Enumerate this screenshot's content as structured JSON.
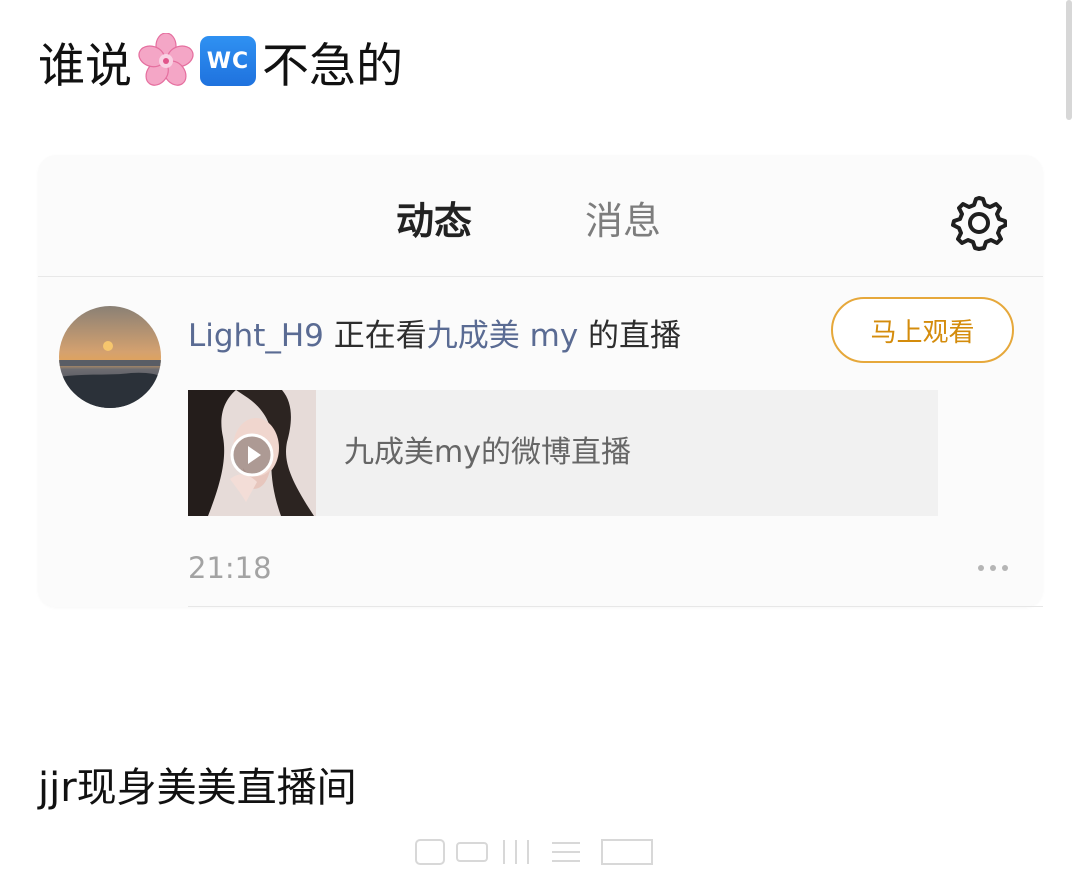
{
  "page": {
    "title_prefix": "谁说",
    "title_badge": "WC",
    "title_suffix": "不急的",
    "caption": "jjr现身美美直播间"
  },
  "card": {
    "tabs": [
      {
        "label": "动态",
        "active": true
      },
      {
        "label": "消息",
        "active": false
      }
    ],
    "feed": {
      "user": "Light_H9",
      "verb": " 正在看",
      "streamer": "九成美 my",
      "suffix": " 的直播",
      "button": "马上观看",
      "live_title": "九成美my的微博直播",
      "time": "21:18"
    }
  },
  "icons": {
    "blossom": "cherry-blossom-icon",
    "wc": "wc-badge-icon",
    "settings": "gear-icon",
    "play": "play-icon",
    "more": "more-icon"
  },
  "colors": {
    "accent": "#f7a80a",
    "link": "#5a6b93",
    "button_border": "#e6a83b",
    "button_text": "#d48c0c"
  }
}
